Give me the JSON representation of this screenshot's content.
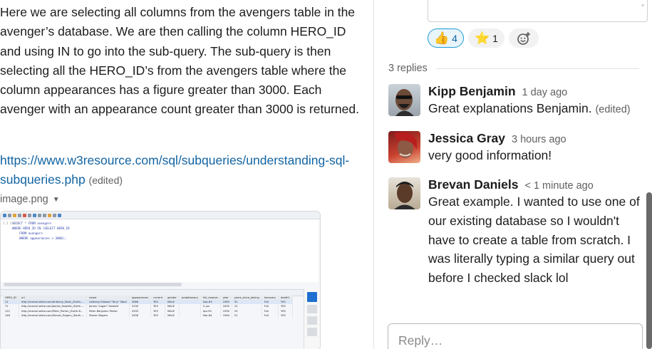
{
  "left_message": {
    "paragraph": "Here we are selecting all columns from the avengers table in the avenger’s database. We are then calling the column HERO_ID and using IN to go into the sub-query. The sub-query is then selecting all the HERO_ID’s from the avengers table where the column appearances has a figure greater than 3000. Each avenger with an appearance count greater than 3000 is returned.",
    "link_text": "https://www.w3resource.com/sql/subqueries/understanding-sql-subqueries.php",
    "edited_label": "(edited)",
    "attachment_name": "image.png",
    "attachment_preview": {
      "line_numbers": [
        "1",
        "2",
        "3",
        "4",
        "5"
      ],
      "code_lines": [
        "SELECT * FROM avengers",
        "WHERE HERO_ID IN (SELECT HERO_ID",
        "    FROM avengers",
        "    WHERE appearances > 3000);",
        ""
      ],
      "result_toolbar": "Result Grid   Filter Rows:        Edit:    Export/Import:    Wrap Cell Content:",
      "columns": [
        "HERO_ID",
        "url",
        "name",
        "appearances",
        "current",
        "gender",
        "probationary",
        "full_reserve",
        "year",
        "years_since_joining",
        "honorary",
        "death1"
      ],
      "rows": [
        [
          "11",
          "http://marvel.wikia.com/Anthony_Stark_(Earth-...",
          "Anthony Edward \"Tony\" Stark",
          "3068",
          "YES",
          "MALE",
          "",
          "Sep-63",
          "1963",
          "52",
          "Full",
          "YES"
        ],
        [
          "71",
          "http://marvel.wikia.com/James_Howlett_(Earth-...",
          "James \"Logan\" Howlett",
          "3130",
          "YES",
          "MALE",
          "",
          "5-Jun",
          "2005",
          "10",
          "Full",
          "YES"
        ],
        [
          "122",
          "http://marvel.wikia.com/Peter_Parker_(Earth-6...",
          "Peter Benjamin Parker",
          "4333",
          "YES",
          "MALE",
          "",
          "Apr-90",
          "1990",
          "25",
          "Full",
          "YES"
        ],
        [
          "148",
          "http://marvel.wikia.com/Steven_Rogers_(Earth-...",
          "Steven Rogers",
          "3458",
          "YES",
          "MALE",
          "",
          "Mar-64",
          "1964",
          "51",
          "Full",
          "YES"
        ]
      ]
    }
  },
  "reactions": [
    {
      "emoji": "👍",
      "count": "4",
      "active": true
    },
    {
      "emoji": "⭐",
      "count": "1",
      "active": false
    }
  ],
  "add_reaction_icon": "add-emoji-icon",
  "replies_label": "3 replies",
  "replies": [
    {
      "author": "Kipp Benjamin",
      "time": "1 day ago",
      "text": "Great explanations Benjamin.",
      "edited": "(edited)"
    },
    {
      "author": "Jessica Gray",
      "time": "3 hours ago",
      "text": "very good information!"
    },
    {
      "author": "Brevan Daniels",
      "time": "< 1 minute ago",
      "text": "Great example. I wanted to use one of our existing database so I wouldn't have to  create a  table from scratch. I was literally typing a similar query out before I checked slack lol"
    }
  ],
  "reply_input": {
    "placeholder": "Reply…",
    "value": ""
  },
  "colors": {
    "link": "#1264a3",
    "reaction_active_border": "#1d9bd1",
    "reaction_active_bg": "#e8f5fa"
  }
}
